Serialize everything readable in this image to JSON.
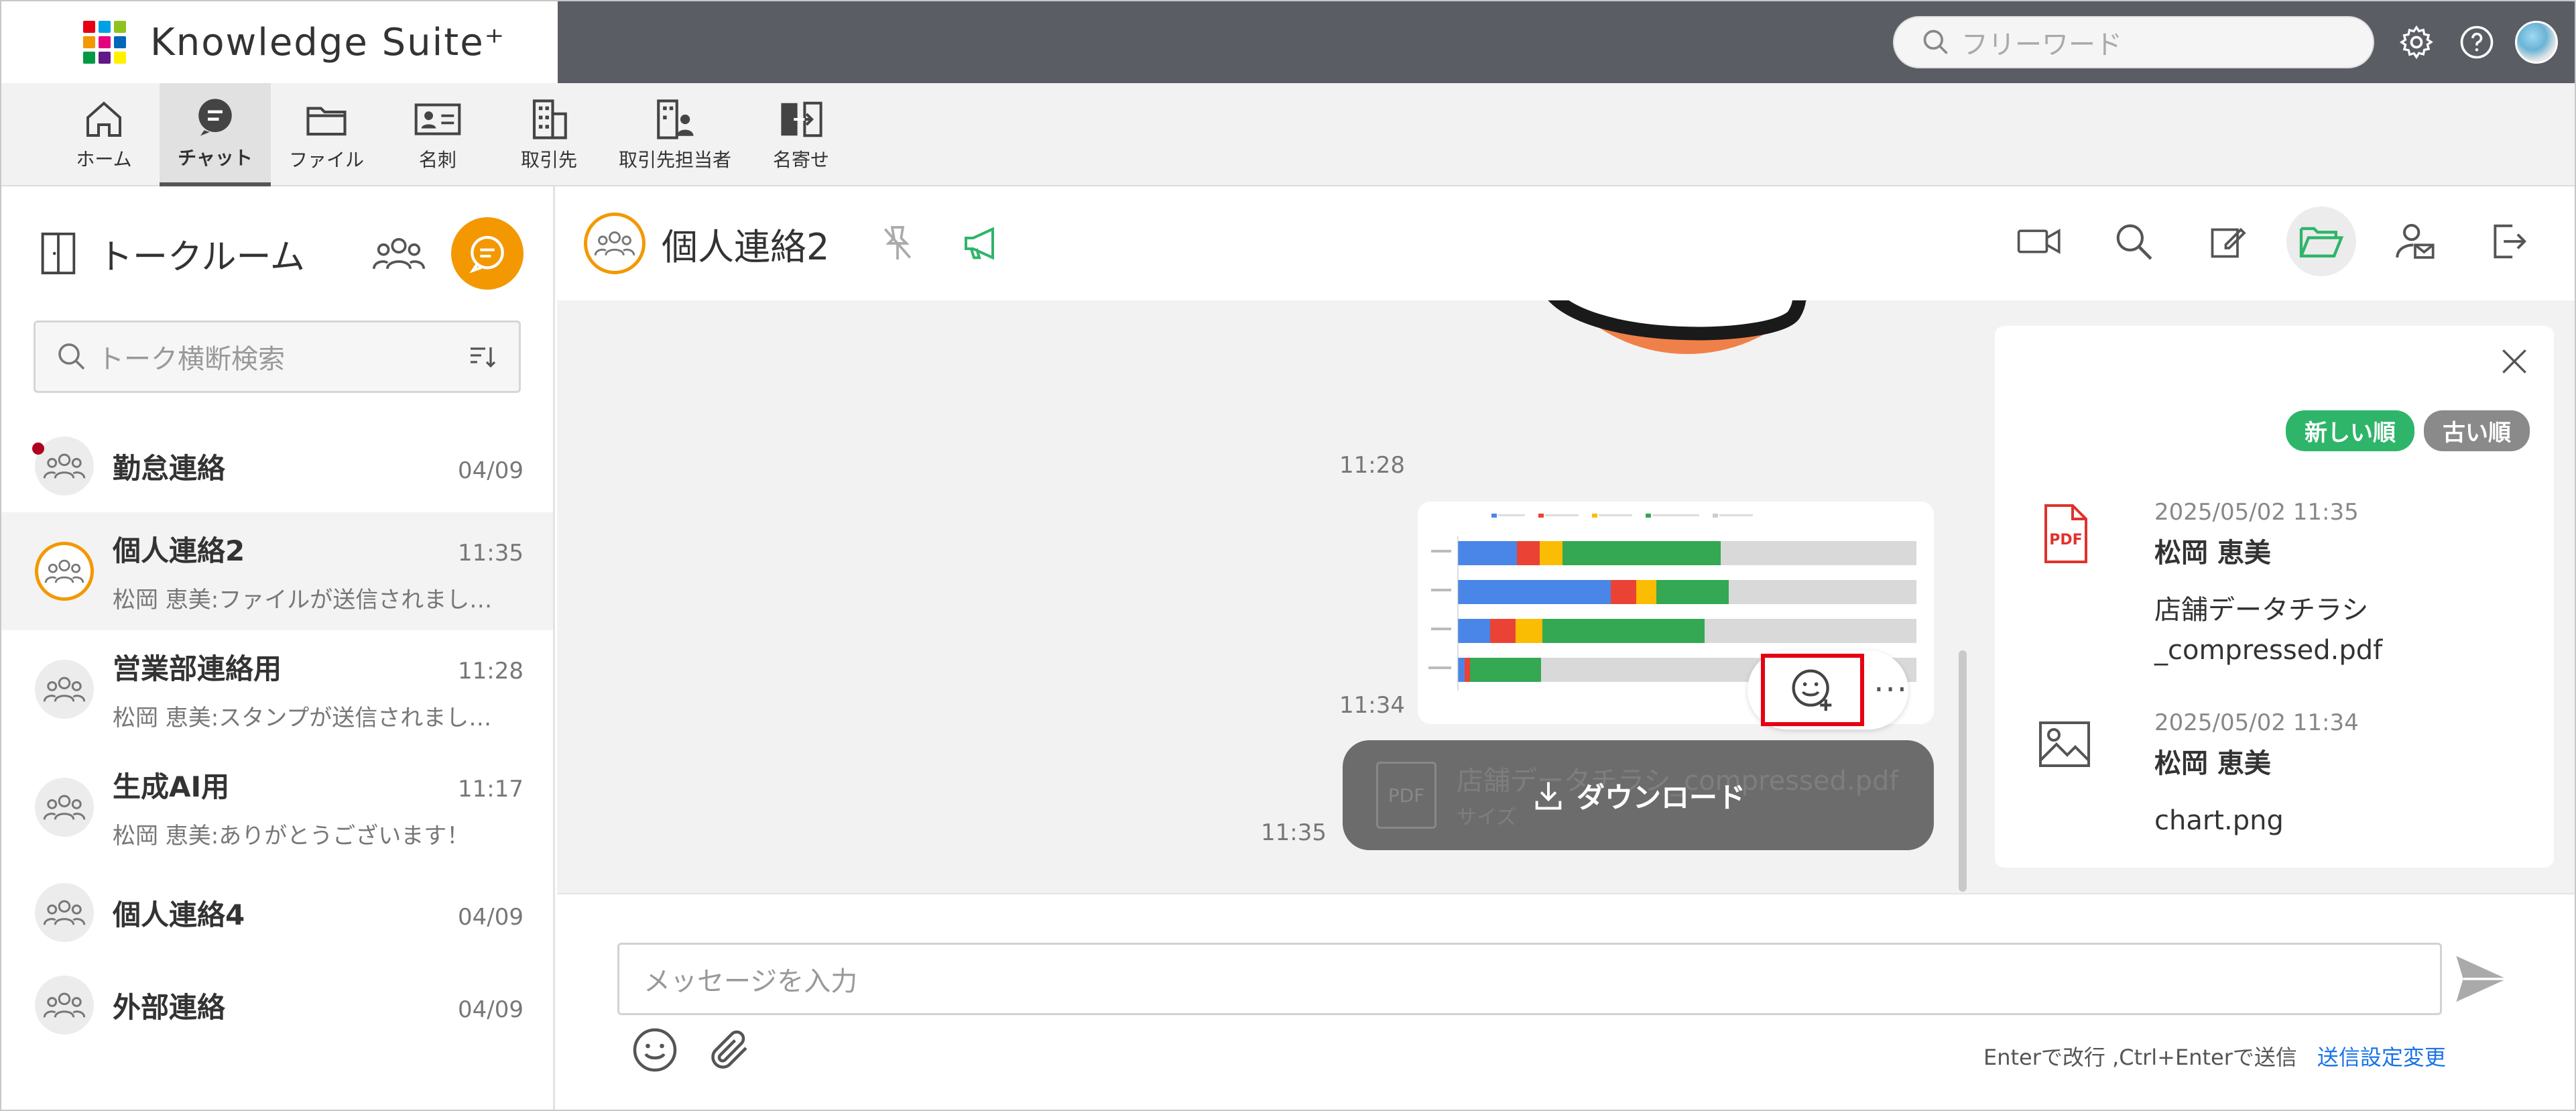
{
  "brand": {
    "name": "Knowledge Suite⁺",
    "colors": [
      "#e60012",
      "#00a0e9",
      "#8fc31f",
      "#f39800",
      "#e4007f",
      "#0068b7",
      "#009944",
      "#601986",
      "#fff100"
    ]
  },
  "topbar": {
    "search_placeholder": "フリーワード",
    "icons": [
      "search-icon",
      "gear-icon",
      "help-icon",
      "user-avatar"
    ]
  },
  "nav": {
    "items": [
      {
        "label": "ホーム",
        "icon": "home-icon"
      },
      {
        "label": "チャット",
        "icon": "chat-icon",
        "active": true
      },
      {
        "label": "ファイル",
        "icon": "folder-icon"
      },
      {
        "label": "名刺",
        "icon": "business-card-icon"
      },
      {
        "label": "取引先",
        "icon": "building-icon"
      },
      {
        "label": "取引先担当者",
        "icon": "building-person-icon"
      },
      {
        "label": "名寄せ",
        "icon": "merge-icon"
      }
    ]
  },
  "left": {
    "title": "トークルーム",
    "search_placeholder": "トーク横断検索",
    "rooms": [
      {
        "name": "勤怠連絡",
        "time": "04/09",
        "preview": "",
        "unread": true
      },
      {
        "name": "個人連絡2",
        "time": "11:35",
        "preview": "松岡 恵美:ファイルが送信されまし…",
        "active": true
      },
      {
        "name": "営業部連絡用",
        "time": "11:28",
        "preview": "松岡 恵美:スタンプが送信されまし…"
      },
      {
        "name": "生成AI用",
        "time": "11:17",
        "preview": "松岡 恵美:ありがとうございます！"
      },
      {
        "name": "個人連絡4",
        "time": "04/09",
        "preview": ""
      },
      {
        "name": "外部連絡",
        "time": "04/09",
        "preview": ""
      }
    ]
  },
  "chat": {
    "title": "個人連絡2",
    "header_icons": [
      "pin-icon",
      "megaphone-icon",
      "video-icon",
      "search-icon",
      "edit-icon",
      "folder-open-icon",
      "member-mail-icon",
      "exit-icon"
    ],
    "messages": [
      {
        "time": "11:28",
        "type": "stamp"
      },
      {
        "time": "11:34",
        "type": "image"
      },
      {
        "time": "11:35",
        "type": "file",
        "file_name": "店舗データチラシ_compressed.pdf",
        "file_size": "サイズ",
        "file_icon": "PDF"
      }
    ],
    "download_label": "ダウンロード",
    "more_label": "···"
  },
  "files_panel": {
    "sort_new": "新しい順",
    "sort_old": "古い順",
    "accent": "#2fb56a",
    "items": [
      {
        "date": "2025/05/02 11:35",
        "user": "松岡 恵美",
        "name_line1": "店舗データチラシ",
        "name_line2": "_compressed.pdf",
        "icon": "PDF"
      },
      {
        "date": "2025/05/02 11:34",
        "user": "松岡 恵美",
        "name_line1": "chart.png",
        "name_line2": "",
        "icon": "image-icon"
      }
    ]
  },
  "composer": {
    "placeholder": "メッセージを入力",
    "hint": "Enterで改行 ,Ctrl+Enterで送信",
    "settings_link": "送信設定変更"
  }
}
